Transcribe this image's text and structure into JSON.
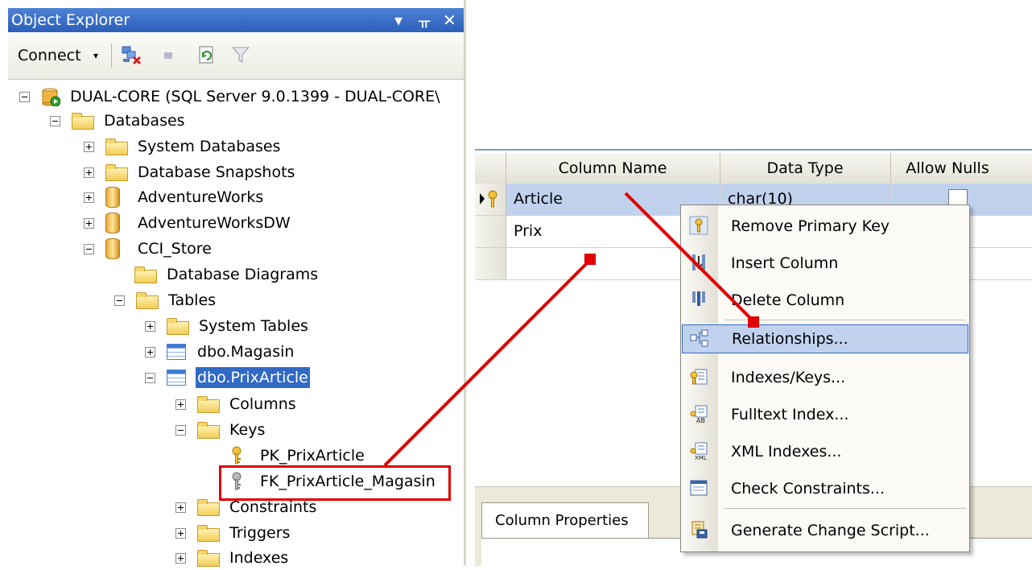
{
  "object_explorer": {
    "title": "Object Explorer",
    "title_controls": [
      "▾",
      "ᚂ",
      "✕"
    ],
    "toolbar": {
      "connect_label": "Connect",
      "connect_caret": "▾"
    },
    "tree": {
      "server": "DUAL-CORE (SQL Server 9.0.1399 - DUAL-CORE\\",
      "databases": "Databases",
      "system_databases": "System Databases",
      "database_snapshots": "Database Snapshots",
      "adventureworks": "AdventureWorks",
      "adventureworksdw": "AdventureWorksDW",
      "cci_store": "CCI_Store",
      "database_diagrams": "Database Diagrams",
      "tables": "Tables",
      "system_tables": "System Tables",
      "dbo_magasin": "dbo.Magasin",
      "dbo_prixarticle": "dbo.PrixArticle",
      "columns": "Columns",
      "keys": "Keys",
      "pk_prixarticle": "PK_PrixArticle",
      "fk_prixarticle_magasin": "FK_PrixArticle_Magasin",
      "constraints": "Constraints",
      "triggers": "Triggers",
      "indexes": "Indexes"
    }
  },
  "designer": {
    "headers": {
      "column_name": "Column Name",
      "data_type": "Data Type",
      "allow_nulls": "Allow Nulls"
    },
    "rows": [
      {
        "column_name": "Article",
        "data_type": "char(10)"
      },
      {
        "column_name": "Prix",
        "data_type": ""
      }
    ],
    "properties_tab": "Column Properties"
  },
  "context_menu": {
    "items": [
      {
        "label": "Remove Primary Key",
        "icon": "primary-key-icon"
      },
      {
        "label": "Insert Column",
        "icon": "insert-column-icon"
      },
      {
        "label": "Delete Column",
        "icon": "delete-column-icon"
      },
      {
        "label": "Relationships...",
        "icon": "relationships-icon",
        "highlighted": true
      },
      {
        "label": "Indexes/Keys...",
        "icon": "indexes-keys-icon"
      },
      {
        "label": "Fulltext Index...",
        "icon": "fulltext-index-icon"
      },
      {
        "label": "XML Indexes...",
        "icon": "xml-indexes-icon"
      },
      {
        "label": "Check Constraints...",
        "icon": "check-constraints-icon"
      },
      {
        "label": "Generate Change Script...",
        "icon": "generate-script-icon"
      }
    ]
  },
  "colors": {
    "annotation_red": "#e00000",
    "selection_blue": "#316ac5",
    "menu_highlight": "#c1d2ee",
    "title_bar_blue": "#3a6fc8"
  }
}
